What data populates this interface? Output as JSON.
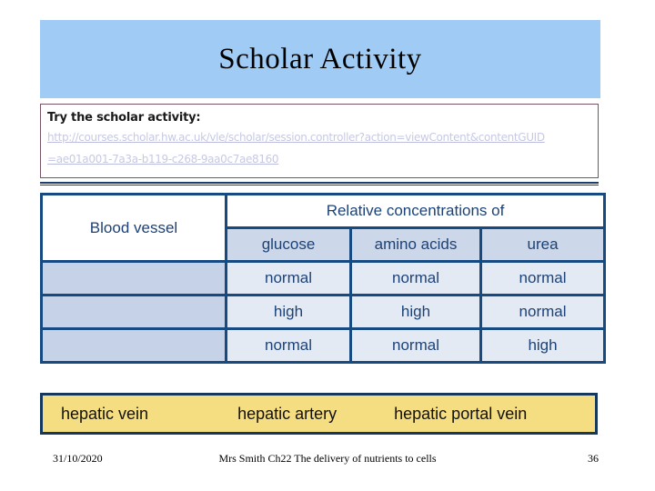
{
  "slide": {
    "title": "Scholar Activity",
    "title_band_color": "#9fcbf5"
  },
  "activity": {
    "prompt": "Try the scholar activity:",
    "link_line_1": "http://courses.scholar.hw.ac.uk/vle/scholar/session.controller?action=viewContent&contentGUID",
    "link_line_2": "=ae01a001-7a3a-b119-c268-9aa0c7ae8160",
    "link_color": "#c7c9e4",
    "border_color": "#7a5364"
  },
  "table": {
    "vessel_header": "Blood vessel",
    "group_header": "Relative concentrations of",
    "sub_headers": [
      "glucose",
      "amino acids",
      "urea"
    ],
    "rows": [
      {
        "vessel": "",
        "values": [
          "normal",
          "normal",
          "normal"
        ]
      },
      {
        "vessel": "",
        "values": [
          "high",
          "high",
          "normal"
        ]
      },
      {
        "vessel": "",
        "values": [
          "normal",
          "normal",
          "high"
        ]
      }
    ],
    "border_color": "#174a80",
    "text_color": "#1c4278"
  },
  "answers": {
    "terms": [
      "hepatic vein",
      "hepatic artery",
      "hepatic portal vein"
    ],
    "background_color": "#f5dd81",
    "border_color": "#16385c"
  },
  "footer": {
    "date": "31/10/2020",
    "center": "Mrs Smith Ch22 The delivery of nutrients to cells",
    "page_number": "36"
  }
}
